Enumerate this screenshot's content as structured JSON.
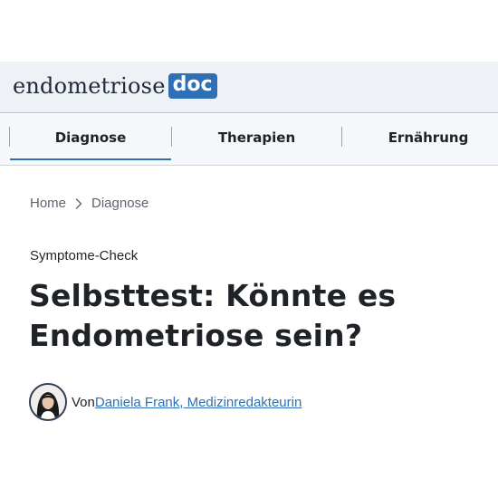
{
  "brand": {
    "logo_text": "endometriose",
    "logo_badge": "doc",
    "accent_color": "#2f6fb5"
  },
  "nav": {
    "tabs": [
      {
        "label": "Diagnose",
        "active": true
      },
      {
        "label": "Therapien",
        "active": false
      },
      {
        "label": "Ernährung",
        "active": false
      }
    ]
  },
  "breadcrumb": {
    "home": "Home",
    "separator_icon": "chevron-right-icon",
    "current": "Diagnose"
  },
  "article": {
    "kicker": "Symptome-Check",
    "title_line1": "Selbsttest: Könnte es",
    "title_line2": "Endometriose sein?",
    "author_prefix": "Von",
    "author_name": " Daniela Frank, Medizinredakteurin"
  }
}
